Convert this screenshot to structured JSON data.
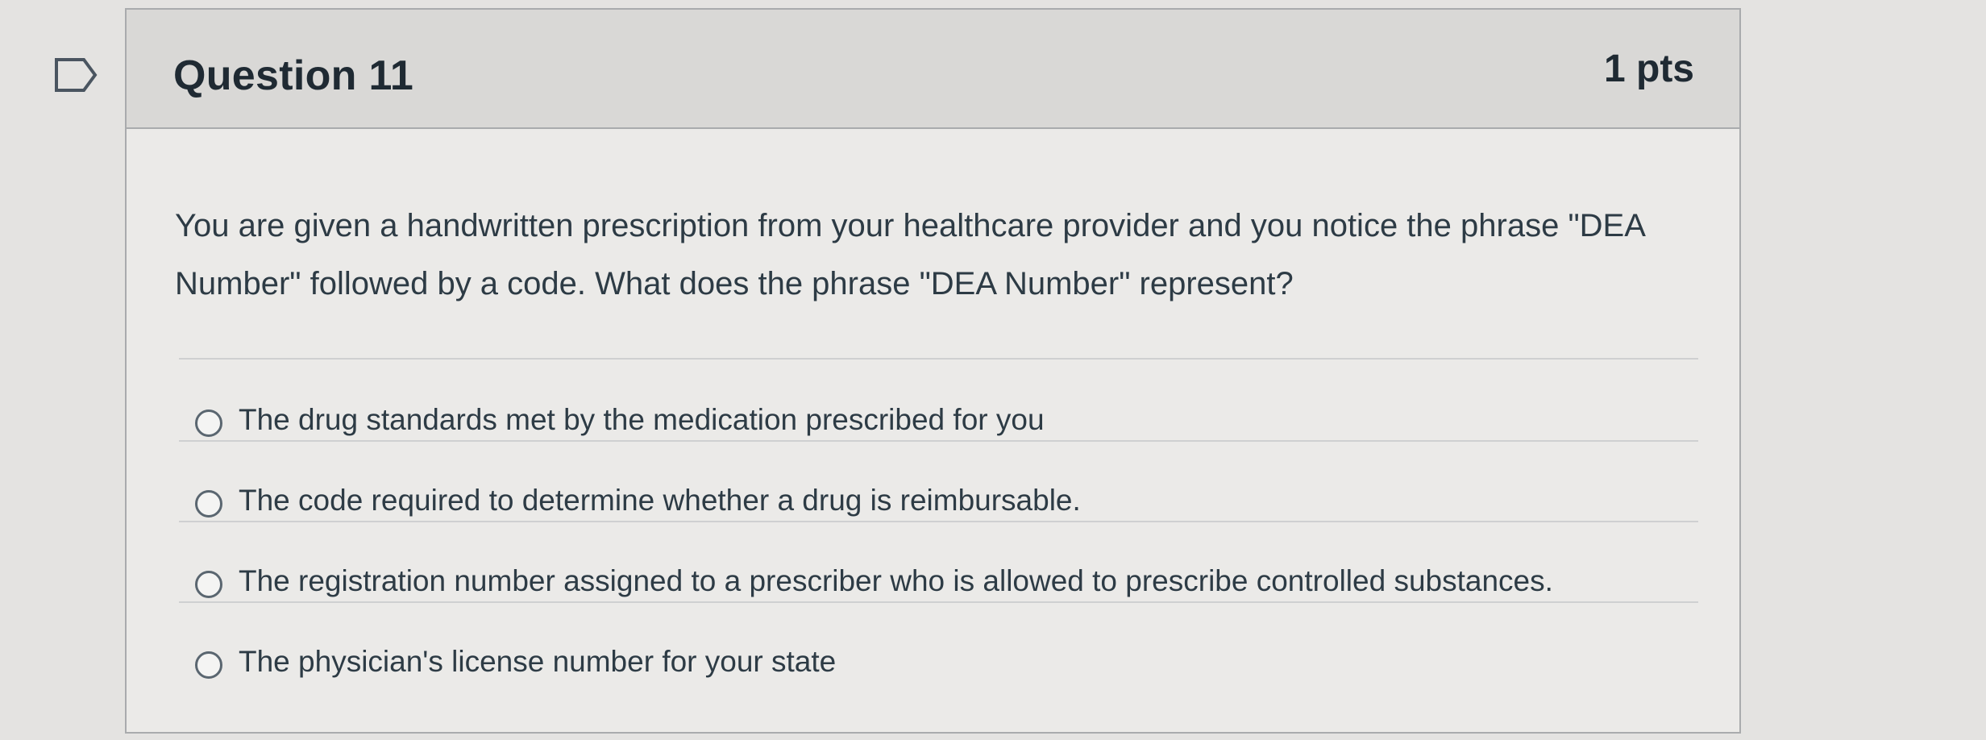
{
  "question": {
    "title": "Question 11",
    "points": "1 pts",
    "text": "You are given a handwritten prescription from your healthcare provider and you notice the phrase \"DEA Number\" followed by a code. What does the phrase \"DEA Number\" represent?"
  },
  "answers": [
    {
      "label": "The drug standards met by the medication prescribed for you"
    },
    {
      "label": "The code required to determine whether a drug is reimbursable."
    },
    {
      "label": "The registration number assigned to a prescriber who is allowed to prescribe controlled substances."
    },
    {
      "label": "The physician's license number for your state"
    }
  ],
  "icons": {
    "flag": "flag-icon",
    "radio": "radio-unchecked-icon"
  },
  "colors": {
    "header_background": "#d9d8d6",
    "card_background": "#ebeae8",
    "text": "#2d3b45",
    "border": "#a9abad"
  }
}
